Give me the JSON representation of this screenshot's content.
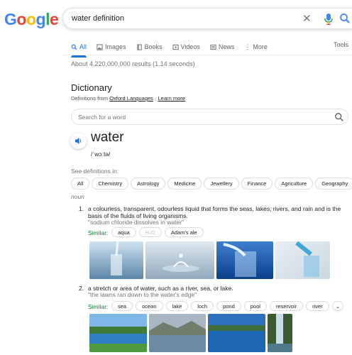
{
  "logo": {
    "letters": [
      "G",
      "o",
      "o",
      "g",
      "l",
      "e"
    ],
    "colors": [
      "#4285F4",
      "#EA4335",
      "#FBBC05",
      "#4285F4",
      "#34A853",
      "#EA4335"
    ]
  },
  "search": {
    "query": "water definition"
  },
  "tabs": [
    {
      "label": "All",
      "icon": "search-icon"
    },
    {
      "label": "Images",
      "icon": "image-icon"
    },
    {
      "label": "Books",
      "icon": "book-icon"
    },
    {
      "label": "Videos",
      "icon": "video-icon"
    },
    {
      "label": "News",
      "icon": "news-icon"
    },
    {
      "label": "More",
      "icon": "more-vert-icon"
    }
  ],
  "tools_label": "Tools",
  "result_stats": "About 4,220,000,000 results (1.14 seconds)",
  "dictionary": {
    "title": "Dictionary",
    "source_prefix": "Definitions from",
    "source_link": "Oxford Languages",
    "separator": "·",
    "learn_more": "Learn more",
    "search_placeholder": "Search for a word",
    "word": "water",
    "phonetic": "/ˈwɔːtə/",
    "see_definitions_in": "See definitions in:",
    "categories": [
      "All",
      "Chemistry",
      "Astrology",
      "Medicine",
      "Jewellery",
      "Finance",
      "Agriculture",
      "Geography"
    ],
    "part_of_speech": "noun",
    "senses": [
      {
        "number": "1.",
        "definition_line1": "a colourless, transparent, odourless liquid that forms the seas, lakes, rivers, and rain and is the",
        "definition_line2": "basis of the fluids of living organisms.",
        "example": "\"sodium chloride dissolves in water\"",
        "similar_label": "Similar:",
        "similar": [
          "aqua",
          "H₂O",
          "Adam's ale"
        ]
      },
      {
        "number": "2.",
        "definition_line1": "a stretch or area of water, such as a river, sea, or lake.",
        "example": "\"the lawns ran down to the water's edge\"",
        "similar_label": "Similar:",
        "similar": [
          "sea",
          "ocean",
          "lake",
          "loch",
          "pond",
          "pool",
          "reservoir",
          "river"
        ]
      }
    ]
  },
  "colors": {
    "accent": "#1a73e8",
    "similar_green": "#188038"
  }
}
